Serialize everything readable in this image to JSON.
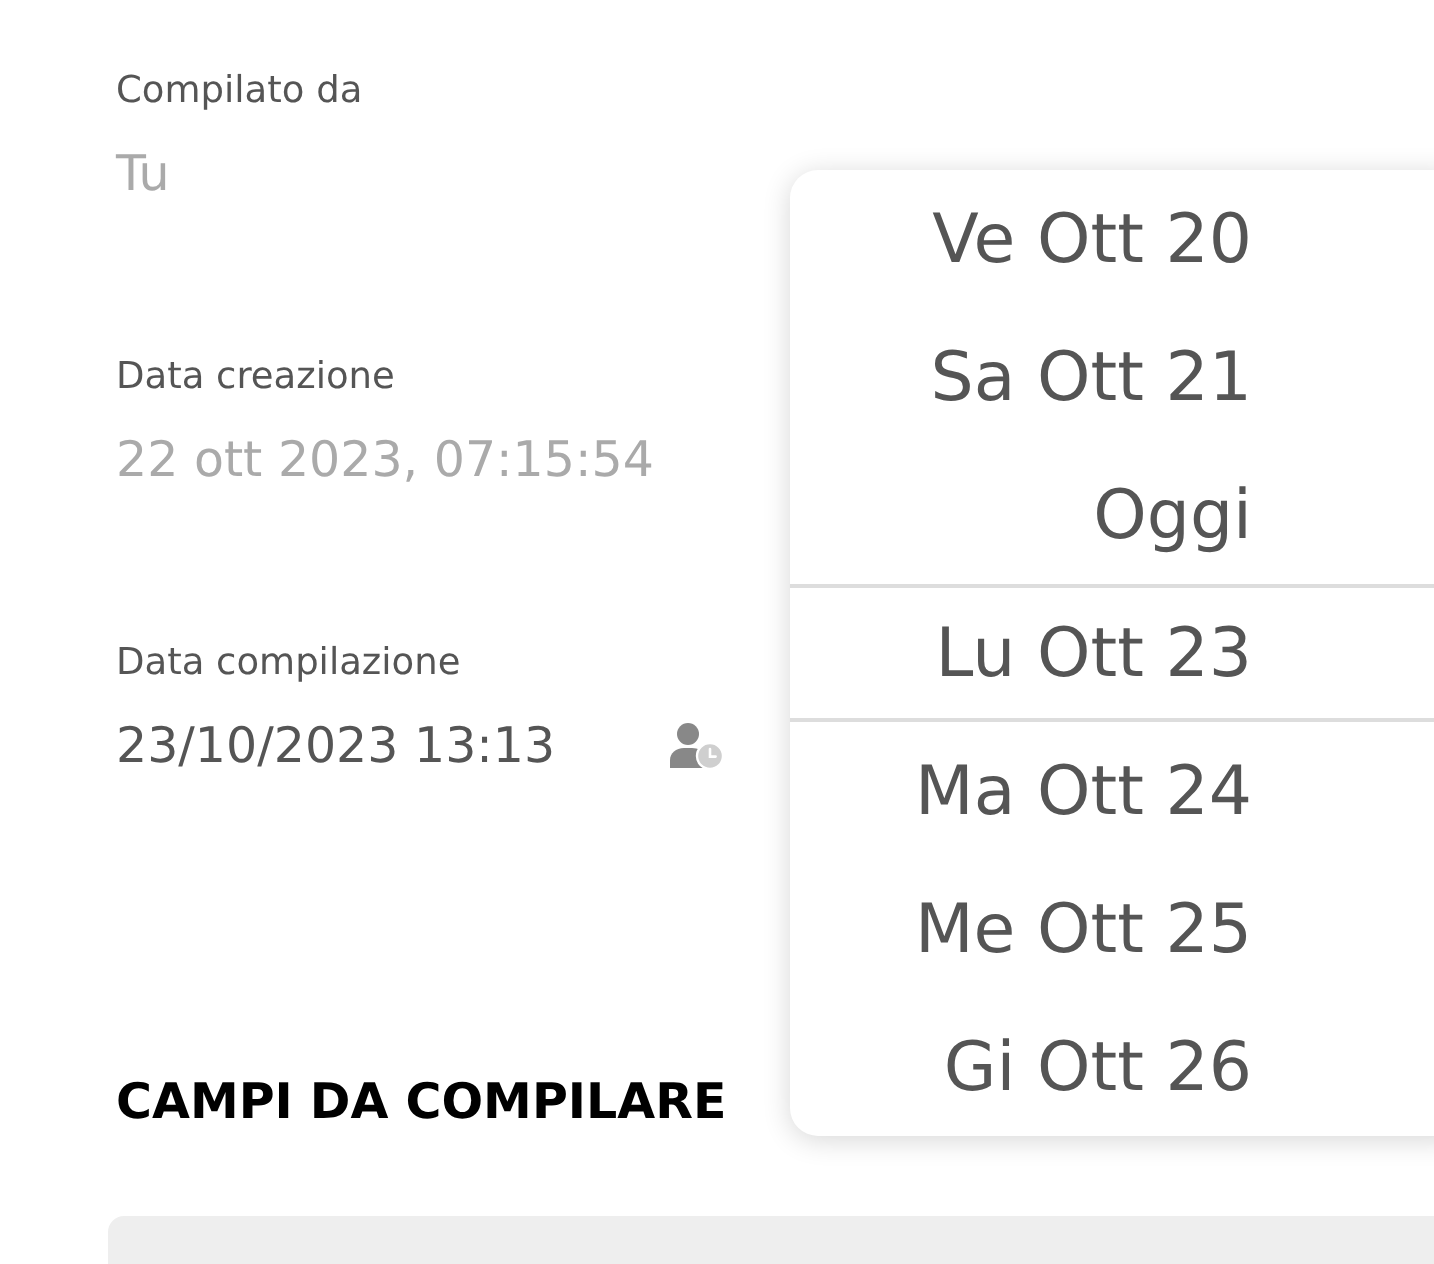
{
  "fields": [
    {
      "label": "Compilato da",
      "value": "Tu",
      "disabled": true,
      "kind": "text"
    },
    {
      "label": "Data creazione",
      "value": "22 ott 2023, 07:15:54",
      "disabled": true,
      "kind": "text"
    },
    {
      "label": "Data compilazione",
      "value": "23/10/2023 13:13",
      "disabled": false,
      "kind": "datetime"
    }
  ],
  "section": {
    "title": "CAMPI DA COMPILARE"
  },
  "date_picker": {
    "items": [
      {
        "label": "Ve Ott 20",
        "selected": false
      },
      {
        "label": "Sa Ott 21",
        "selected": false
      },
      {
        "label": "Oggi",
        "selected": false
      },
      {
        "label": "Lu Ott 23",
        "selected": true
      },
      {
        "label": "Ma Ott 24",
        "selected": false
      },
      {
        "label": "Me Ott 25",
        "selected": false
      },
      {
        "label": "Gi Ott 26",
        "selected": false
      }
    ]
  }
}
